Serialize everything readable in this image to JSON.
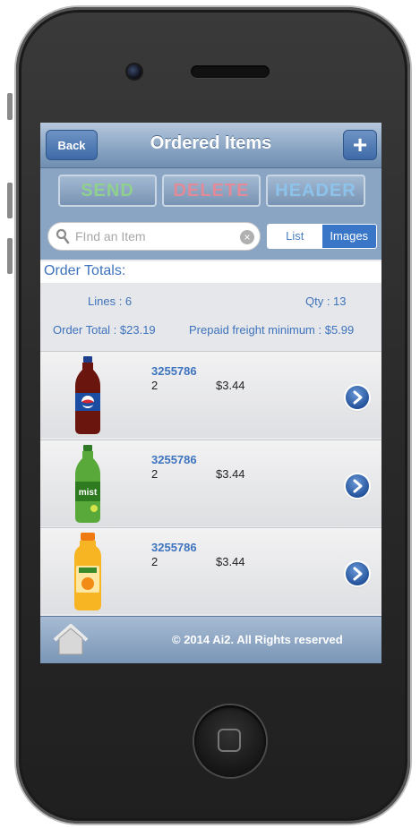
{
  "navbar": {
    "back_label": "Back",
    "title": "Ordered Items",
    "add_label": "+"
  },
  "actions": {
    "send_label": "SEND",
    "delete_label": "DELETE",
    "header_label": "HEADER"
  },
  "search": {
    "placeholder": "FInd an Item",
    "clear_glyph": "×"
  },
  "view_toggle": {
    "list_label": "List",
    "images_label": "Images",
    "selected": "Images"
  },
  "totals": {
    "title": "Order Totals:",
    "lines": "Lines : 6",
    "qty": "Qty : 13",
    "order_total": "Order Total : $23.19",
    "freight": "Prepaid freight minimum : $5.99"
  },
  "items": [
    {
      "code": "3255786",
      "qty": "2",
      "price": "$3.44",
      "product_icon": "cola-bottle-icon",
      "color": "#7a1a12"
    },
    {
      "code": "3255786",
      "qty": "2",
      "price": "$3.44",
      "product_icon": "lemon-lime-bottle-icon",
      "color": "#4a9a2a"
    },
    {
      "code": "3255786",
      "qty": "2",
      "price": "$3.44",
      "product_icon": "orange-juice-bottle-icon",
      "color": "#f2a21a"
    }
  ],
  "footer": {
    "copyright": "© 2014 Ai2. All Rights reserved"
  },
  "colors": {
    "accent": "#3e73bd",
    "nav": "#8aa5c3"
  }
}
